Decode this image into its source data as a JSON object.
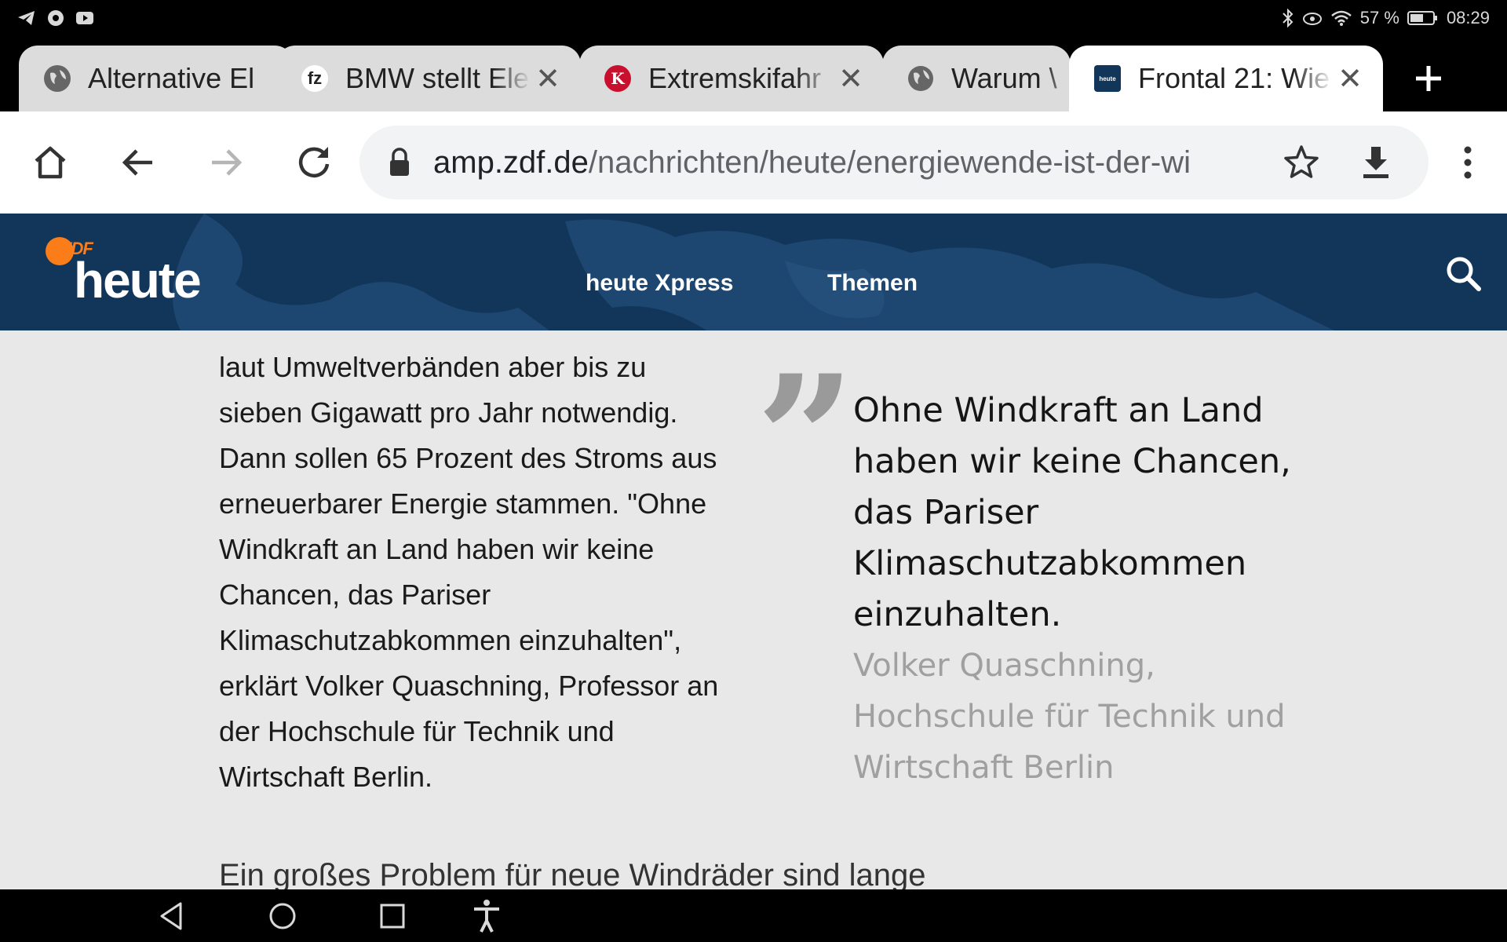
{
  "status_bar": {
    "battery": "57 %",
    "time": "08:29"
  },
  "tabs": [
    {
      "title": "Alternative El",
      "favicon": "globe-icon",
      "active": false,
      "has_close": false
    },
    {
      "title": "BMW stellt Ele",
      "favicon": "fz",
      "active": false,
      "has_close": true
    },
    {
      "title": "Extremskifahr",
      "favicon": "K",
      "active": false,
      "has_close": true
    },
    {
      "title": "Warum \\",
      "favicon": "globe-icon",
      "active": false,
      "has_close": false
    },
    {
      "title": "Frontal 21: Wie",
      "favicon": "heute-favicon",
      "active": true,
      "has_close": true
    }
  ],
  "omnibox": {
    "domain": "amp.zdf.de",
    "path": "/nachrichten/heute/energiewende-ist-der-wi"
  },
  "site": {
    "logo_zdf": "ZDF",
    "logo_heute": "heute",
    "nav": [
      "heute Xpress",
      "Themen"
    ]
  },
  "article": {
    "body": "laut Umweltverbänden aber bis zu\nsieben Gigawatt pro Jahr notwendig.\nDann sollen 65 Prozent des Stroms aus\nerneuerbarer Energie stammen. \"Ohne\nWindkraft an Land haben wir keine\nChancen, das Pariser\nKlimaschutzabkommen einzuhalten\",\nerklärt Volker Quaschning, Professor an\nder Hochschule für Technik und\nWirtschaft Berlin.",
    "quote_mark": "”",
    "quote": "Ohne Windkraft an Land\nhaben wir keine Chancen,\ndas Pariser\nKlimaschutzabkommen\neinzuhalten.",
    "quote_source": "Volker Quaschning,\nHochschule für Technik und\nWirtschaft Berlin",
    "next_paragraph": "Ein großes Problem für neue Windräder sind lange"
  },
  "colors": {
    "header_bg": "#12365a",
    "zdf_orange": "#fa7d19",
    "content_bg": "#e8e8e8"
  }
}
